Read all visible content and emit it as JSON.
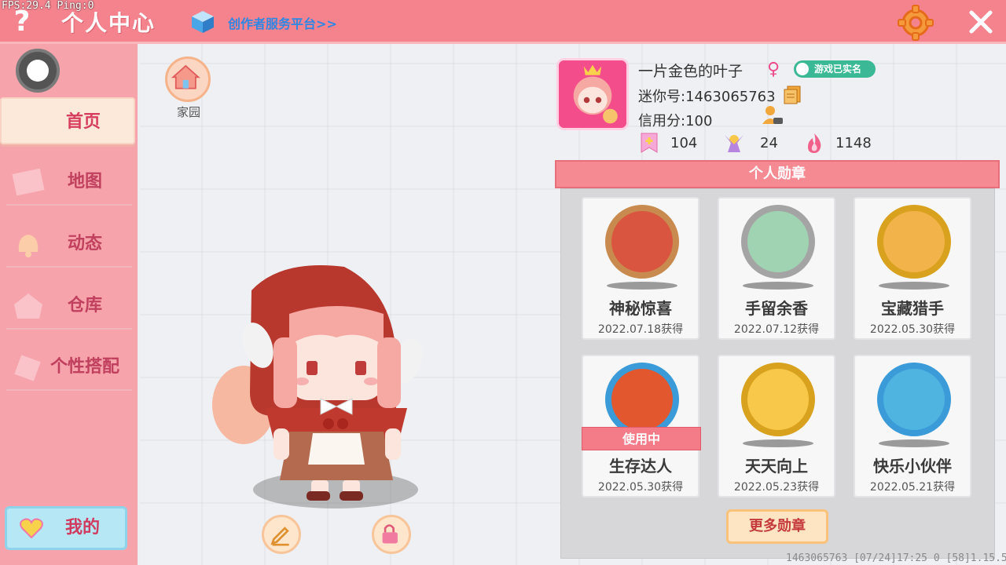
{
  "debug": {
    "fps": "FPS:29.4  Ping:0"
  },
  "header": {
    "help_label": "?",
    "title": "个人中心",
    "creator_link": "创作者服务平台>>"
  },
  "sidebar": {
    "items": [
      {
        "label": "首页",
        "active": true
      },
      {
        "label": "地图"
      },
      {
        "label": "动态"
      },
      {
        "label": "仓库"
      },
      {
        "label": "个性搭配"
      }
    ],
    "mine_label": "我的"
  },
  "main": {
    "home_label": "家园"
  },
  "profile": {
    "name": "一片金色的叶子",
    "gender_symbol": "♀",
    "verified": "游戏已实名",
    "mini_id": "迷你号:1463065763",
    "credit": "信用分:100",
    "stats": [
      {
        "icon": "plus-card-icon",
        "value": "104"
      },
      {
        "icon": "fans-icon",
        "value": "24"
      },
      {
        "icon": "flame-icon",
        "value": "1148"
      }
    ]
  },
  "badges": {
    "title": "个人勋章",
    "items": [
      {
        "name": "神秘惊喜",
        "date": "2022.07.18获得",
        "color": "#d9553f",
        "rim": "#c98a50"
      },
      {
        "name": "手留余香",
        "date": "2022.07.12获得",
        "color": "#9fd3b2",
        "rim": "#a4a4a4"
      },
      {
        "name": "宝藏猎手",
        "date": "2022.05.30获得",
        "color": "#f2b34a",
        "rim": "#d9a21e"
      },
      {
        "name": "生存达人",
        "date": "2022.05.30获得",
        "color": "#e2572e",
        "rim": "#3a9bd8",
        "in_use": "使用中"
      },
      {
        "name": "天天向上",
        "date": "2022.05.23获得",
        "color": "#f7c84a",
        "rim": "#d9a21e"
      },
      {
        "name": "快乐小伙伴",
        "date": "2022.05.21获得",
        "color": "#4fb4e0",
        "rim": "#3a9bd8"
      }
    ],
    "more_label": "更多勋章"
  },
  "footer": {
    "info": "1463065763  [07/24]17:25 0  [58]1.15.5"
  },
  "colors": {
    "topbar": "#f4838e",
    "sidebar": "#f6a3ac",
    "accent": "#d63d5f"
  }
}
